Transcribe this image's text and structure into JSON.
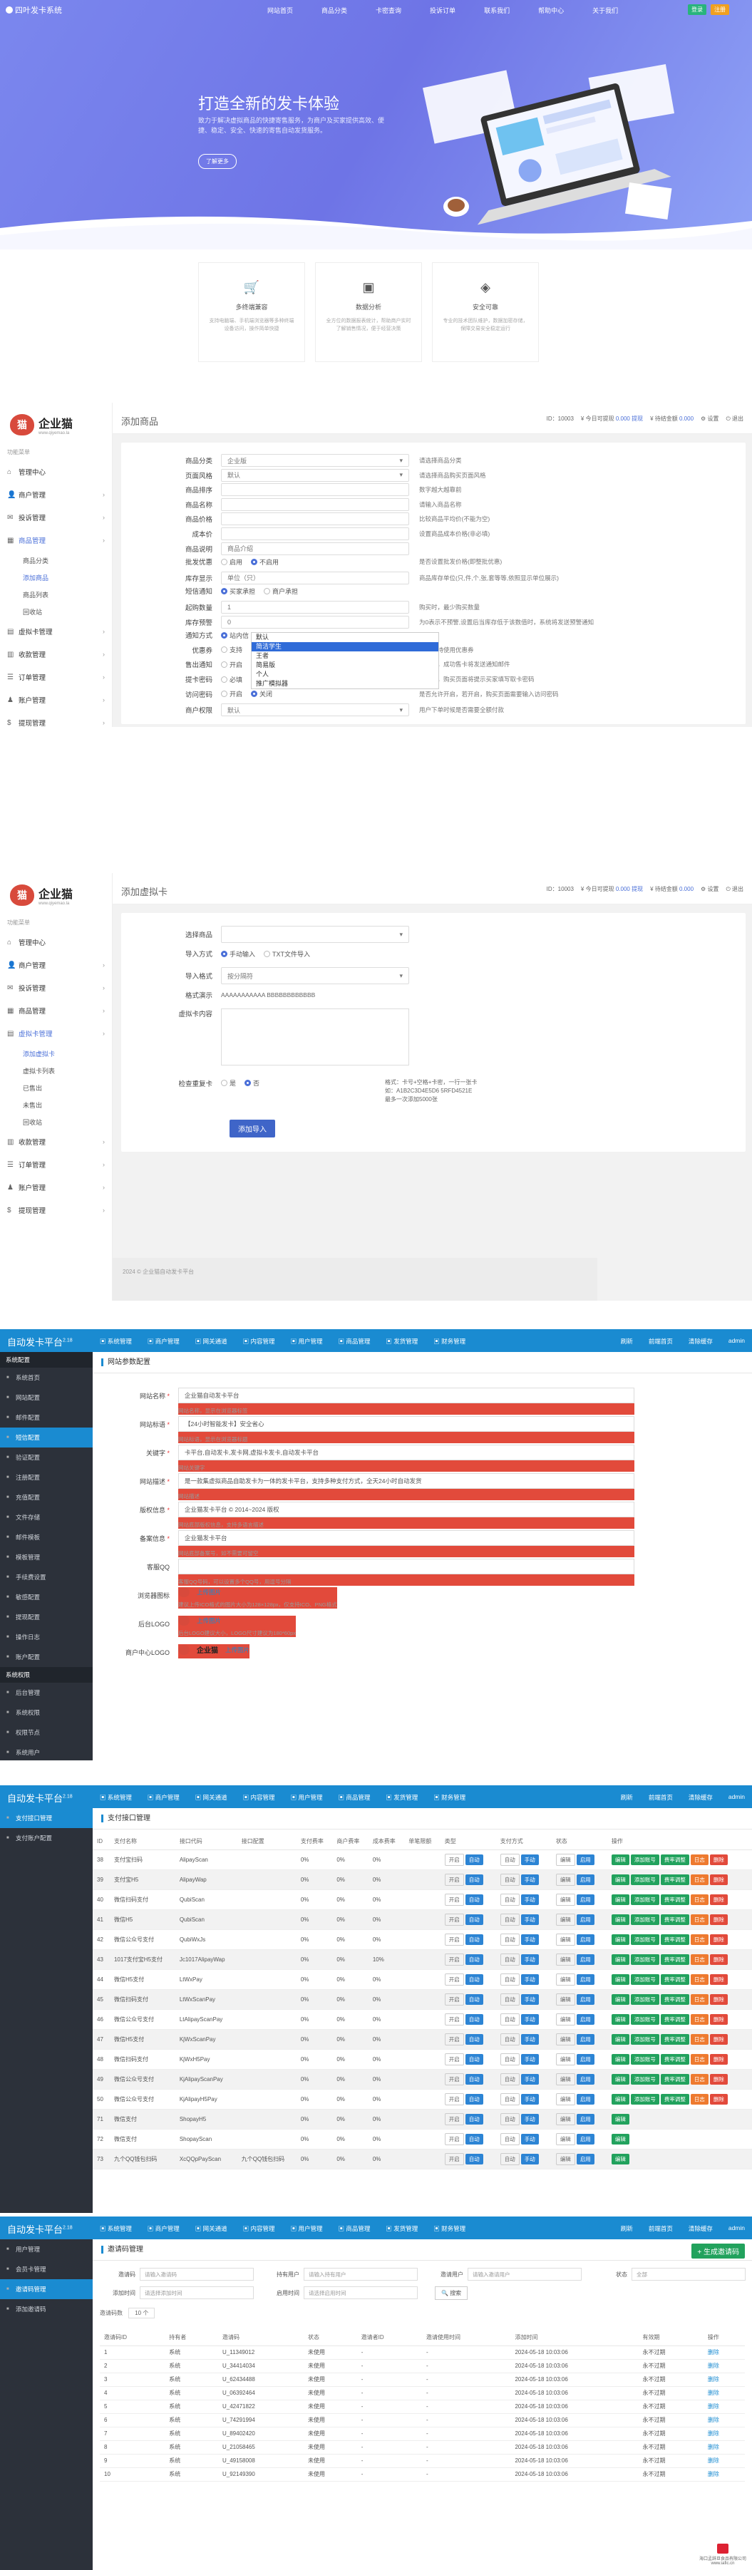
{
  "s1": {
    "logo": "四叶发卡系统",
    "nav": [
      "网站首页",
      "商品分类",
      "卡密查询",
      "投诉订单",
      "联系我们",
      "帮助中心",
      "关于我们"
    ],
    "nav_buttons": [
      "登录",
      "注册"
    ],
    "hero_title": "打造全新的发卡体验",
    "hero_sub": "致力于解决虚拟商品的快捷寄售服务，为商户及买家提供高效、便捷、稳定、安全、快速的寄售自动发货服务。",
    "hero_more": "了解更多",
    "features": [
      {
        "icon": "shopping-cart-icon",
        "title": "多终端兼容",
        "desc": "支持电脑端、手机端浏览器等多种终端设备访问，操作简单快捷"
      },
      {
        "icon": "data-report-icon",
        "title": "数据分析",
        "desc": "全方位的数据报表统计，帮助商户实时了解销售情况，便于经营决策"
      },
      {
        "icon": "safety-icon",
        "title": "安全可靠",
        "desc": "专业的技术团队维护，数据加密存储，保障交易安全稳定运行"
      }
    ]
  },
  "admin": {
    "brand": "企业猫",
    "brand_url": "www.qiyemao.la",
    "nav_caption": "功能菜单",
    "stats": {
      "id": "ID：10003",
      "balance_label": "¥ 今日可提现",
      "balance": "0.000",
      "withdraw_label": "提现",
      "freeze_label": "¥ 待结金额",
      "freeze": "0.000",
      "settings": "设置",
      "logout": "退出"
    }
  },
  "s2": {
    "page_title": "添加商品",
    "side": [
      {
        "icon": "home-icon",
        "label": "管理中心"
      },
      {
        "icon": "user-icon",
        "label": "商户管理",
        "arrow": true
      },
      {
        "icon": "cart-icon",
        "label": "投诉管理",
        "arrow": true
      },
      {
        "icon": "goods-icon",
        "label": "商品管理",
        "arrow": true,
        "on": true
      },
      {
        "sub": "商品分类"
      },
      {
        "sub": "添加商品",
        "on": true
      },
      {
        "sub": "商品列表"
      },
      {
        "sub": "回收站"
      },
      {
        "icon": "card-icon",
        "label": "虚拟卡管理",
        "arrow": true
      },
      {
        "icon": "chart-icon",
        "label": "收款管理",
        "arrow": true
      },
      {
        "icon": "order-icon",
        "label": "订单管理",
        "arrow": true
      },
      {
        "icon": "account-icon",
        "label": "账户管理",
        "arrow": true
      },
      {
        "icon": "money-icon",
        "label": "提现管理",
        "arrow": true
      }
    ],
    "rows": [
      {
        "label": "商品分类",
        "value": "企业版",
        "help": "请选择商品分类"
      },
      {
        "label": "页面风格",
        "value": "默认",
        "help": "请选择商品购买页面风格"
      },
      {
        "label": "商品排序",
        "value": "",
        "help": "数字越大越靠前"
      },
      {
        "label": "商品名称",
        "value": "",
        "help": "请输入商品名称"
      },
      {
        "label": "商品价格",
        "value": "",
        "help": "比较商品平均价(不能为空)"
      },
      {
        "label": "成本价",
        "value": "",
        "help": "设置商品成本价格(非必填)"
      },
      {
        "label": "商品说明",
        "value": "商品介绍",
        "help": ""
      },
      {
        "label": "批发优惠",
        "radios": [
          "启用",
          "不启用"
        ],
        "on": 1,
        "help": "是否设置批发价格(即整批优惠)"
      },
      {
        "label": "库存显示",
        "value": "单位（只）",
        "help": "商品库存单位(只,件,个,张,套等等,依照显示单位展示)"
      },
      {
        "label": "短信通知",
        "radios": [
          "买家承担",
          "商户承担"
        ],
        "on": 0,
        "help": ""
      },
      {
        "label": "起购数量",
        "value": "1",
        "help": "购买时，最少购买数量"
      },
      {
        "label": "库存预警",
        "value": "0",
        "help": "为0表示不预警,设置后当库存低于该数值时，系统将发送预警通知"
      },
      {
        "label": "通知方式",
        "radios": [
          "站内信",
          "邮件"
        ],
        "on": 0,
        "help": ""
      },
      {
        "label": "优惠券",
        "radios": [
          "支持",
          "不支持"
        ],
        "on": 1,
        "help": "是否支持使用优惠券"
      },
      {
        "label": "售出通知",
        "radios": [
          "开启",
          "关闭"
        ],
        "on": 1,
        "help": "开启后，成功售卡将发送通知邮件"
      },
      {
        "label": "提卡密码",
        "radios": [
          "必填",
          "选填",
          "关闭"
        ],
        "on": 2,
        "help": "开启后，购买页面将提示买家填写取卡密码"
      },
      {
        "label": "访问密码",
        "radios": [
          "开启",
          "关闭"
        ],
        "on": 1,
        "help": "是否允许开启，若开启，购买页面需要输入访问密码"
      },
      {
        "label": "商户权限",
        "value": "默认",
        "help": "用户下单时候是否需要全额付款"
      }
    ],
    "dropdown": [
      "默认",
      "简洁学生",
      "王者",
      "简易版",
      "个人",
      "推广模拟器"
    ]
  },
  "s3": {
    "page_title": "添加虚拟卡",
    "side": [
      {
        "icon": "home-icon",
        "label": "管理中心"
      },
      {
        "icon": "user-icon",
        "label": "商户管理",
        "arrow": true
      },
      {
        "icon": "cart-icon",
        "label": "投诉管理",
        "arrow": true
      },
      {
        "icon": "goods-icon",
        "label": "商品管理",
        "arrow": true
      },
      {
        "icon": "card-icon",
        "label": "虚拟卡管理",
        "arrow": true,
        "on": true
      },
      {
        "sub": "添加虚拟卡",
        "on": true
      },
      {
        "sub": "虚拟卡列表"
      },
      {
        "sub": "已售出"
      },
      {
        "sub": "未售出"
      },
      {
        "sub": "回收站"
      },
      {
        "icon": "chart-icon",
        "label": "收款管理",
        "arrow": true
      },
      {
        "icon": "order-icon",
        "label": "订单管理",
        "arrow": true
      },
      {
        "icon": "account-icon",
        "label": "账户管理",
        "arrow": true
      },
      {
        "icon": "money-icon",
        "label": "提现管理",
        "arrow": true
      }
    ],
    "goods_label": "选择商品",
    "goods_value": "",
    "import_label": "导入方式",
    "import_opts": [
      "手动输入",
      "TXT文件导入"
    ],
    "format_label": "导入格式",
    "format_value": "按分隔符",
    "demo_label": "格式演示",
    "demo_value": "AAAAAAAAAAA BBBBBBBBBBBB",
    "card_label": "虚拟卡内容",
    "check_label": "检查重复卡",
    "check_opts": [
      "是",
      "否"
    ],
    "help": [
      "格式：卡号+空格+卡密，一行一张卡",
      "如：A1B2C3D4E5D6 5RFD4521E",
      "最多一次添加5000张"
    ],
    "submit": "添加导入",
    "footer": "2024 © 企业猫自动发卡平台"
  },
  "blue": {
    "title": "自动发卡平台",
    "version": "2.18",
    "menu": [
      "系统管理",
      "商户管理",
      "网关通道",
      "内容管理",
      "用户管理",
      "商品管理",
      "发货管理",
      "财务管理"
    ],
    "right": [
      "刷新",
      "前端首页",
      "清除缓存",
      "admin"
    ]
  },
  "s4": {
    "side_group": "系统配置",
    "side": [
      "系统首页",
      "网站配置",
      "邮件配置",
      "短信配置",
      "验证配置",
      "注册配置",
      "充值配置",
      "文件存储",
      "邮件模板",
      "模板管理",
      "手续费设置",
      "敏感配置",
      "提现配置",
      "操作日志",
      "账户配置"
    ],
    "side_on": 3,
    "side_group2": "系统权限",
    "side2": [
      "后台管理",
      "系统权限",
      "权限节点",
      "系统用户",
      "后台操作日志",
      "用户操作日志"
    ],
    "head": "网站参数配置",
    "rows": [
      {
        "label": "网站名称",
        "req": true,
        "value": "企业猫自动发卡平台",
        "help": "网站名称，显示在浏览器标签"
      },
      {
        "label": "网站标语",
        "req": true,
        "value": "【24小时智能发卡】安全省心",
        "help": "网站标语，显示在浏览器标题"
      },
      {
        "label": "关键字",
        "req": true,
        "value": "卡平台,自动发卡,发卡网,虚拟卡发卡,自动发卡平台",
        "help": "网站关键字"
      },
      {
        "label": "网站描述",
        "req": true,
        "value": "是一款集虚拟商品自助发卡为一体的发卡平台，支持多种支付方式，全天24小时自动发货",
        "help": "网站描述"
      },
      {
        "label": "版权信息",
        "req": true,
        "value": "企业猫发卡平台 © 2014~2024 版权",
        "help": "网站底部版权信息，支持多语言描述"
      },
      {
        "label": "备案信息",
        "req": true,
        "value": "企业猫发卡平台",
        "help": "网站底部备案号，如不需要可留空"
      },
      {
        "label": "客服QQ",
        "req": false,
        "value": "",
        "help": "客服QQ号码，可以设置多个QQ号，用逗号分隔"
      }
    ],
    "logos": [
      {
        "label": "浏览器图标",
        "btn": "上传图片",
        "help": "建议上传ICO格式的图片大小为128×128px，仅支持ICO、PNG格式"
      },
      {
        "label": "后台LOGO",
        "btn": "上传图片",
        "help": "后台LOGO建议大小，LOGO尺寸建议为180*60px"
      },
      {
        "label": "商户中心LOGO",
        "btn": "上传图片",
        "help": ""
      }
    ],
    "brand": "企业猫"
  },
  "s5": {
    "side": [
      "支付接口管理",
      "支付账户配置"
    ],
    "head": "支付接口管理",
    "cols": [
      "ID",
      "支付名称",
      "接口代码",
      "接口配置",
      "支付费率",
      "商户费率",
      "成本费率",
      "单笔限额",
      "类型",
      "支付方式",
      "状态",
      "操作"
    ],
    "rows": [
      [
        "38",
        "支付宝扫码",
        "AlipayScan",
        "",
        "0%",
        "0%",
        "0%",
        "开启"
      ],
      [
        "39",
        "支付宝H5",
        "AlipayWap",
        "",
        "0%",
        "0%",
        "0%",
        "开启"
      ],
      [
        "40",
        "微信扫码支付",
        "QubiScan",
        "",
        "0%",
        "0%",
        "0%",
        "开启"
      ],
      [
        "41",
        "微信H5",
        "QubiScan",
        "",
        "0%",
        "0%",
        "0%",
        "开启"
      ],
      [
        "42",
        "微信公众号支付",
        "QubiWxJs",
        "",
        "0%",
        "0%",
        "0%",
        "开启"
      ],
      [
        "43",
        "1017支付宝H5支付",
        "Jc1017AlipayWap",
        "",
        "0%",
        "0%",
        "10%",
        "开启"
      ],
      [
        "44",
        "微信H5支付",
        "LtWxPay",
        "",
        "0%",
        "0%",
        "0%",
        "开启"
      ],
      [
        "45",
        "微信扫码支付",
        "LtWxScanPay",
        "",
        "0%",
        "0%",
        "0%",
        "开启"
      ],
      [
        "46",
        "微信公众号支付",
        "LtAlipayScanPay",
        "",
        "0%",
        "0%",
        "0%",
        "开启"
      ],
      [
        "47",
        "微信H5支付",
        "KjWxScanPay",
        "",
        "0%",
        "0%",
        "0%",
        "开启"
      ],
      [
        "48",
        "微信扫码支付",
        "KjWxH5Pay",
        "",
        "0%",
        "0%",
        "0%",
        "开启"
      ],
      [
        "49",
        "微信公众号支付",
        "KjAlipayScanPay",
        "",
        "0%",
        "0%",
        "0%",
        "开启"
      ],
      [
        "50",
        "微信公众号支付",
        "KjAlipayH5Pay",
        "",
        "0%",
        "0%",
        "0%",
        "开启"
      ],
      [
        "71",
        "微信支付",
        "ShopayH5",
        "",
        "0%",
        "0%",
        "0%",
        "开启"
      ],
      [
        "72",
        "微信支付",
        "ShopayScan",
        "",
        "0%",
        "0%",
        "0%",
        "开启"
      ],
      [
        "73",
        "九个QQ钱包扫码",
        "XcQQpPayScan",
        "九个QQ钱包扫码",
        "0%",
        "0%",
        "0%",
        "开启"
      ]
    ],
    "type_btn": "开启",
    "mode_btns": [
      "自动",
      "手动"
    ],
    "status_btns": [
      "启用",
      "编辑"
    ],
    "ops": [
      "编辑",
      "添加账号",
      "费率调整",
      "日志",
      "删除"
    ]
  },
  "s6": {
    "side": [
      "用户管理",
      "会员卡管理",
      "邀请码管理",
      "添加邀请码"
    ],
    "side_on": 2,
    "head": "邀请码管理",
    "add_btn": "+ 生成邀请码",
    "filters": [
      {
        "label": "邀请码",
        "ph": "请输入邀请码"
      },
      {
        "label": "持有用户",
        "ph": "请输入持有用户"
      },
      {
        "label": "邀请用户",
        "ph": "请输入邀请用户"
      },
      {
        "label": "状态",
        "ph": "全部"
      },
      {
        "label": "添加时间",
        "ph": "请选择添加时间"
      },
      {
        "label": "启用时间",
        "ph": "请选择启用时间"
      }
    ],
    "search_btn": "搜索",
    "count_label": "邀请码数",
    "count_value": "10 个",
    "cols": [
      "邀请码ID",
      "持有者",
      "邀请码",
      "状态",
      "邀请者ID",
      "邀请使用时间",
      "添加时间",
      "有效期",
      "操作"
    ],
    "rows": [
      [
        "1",
        "系统",
        "U_11349012",
        "未使用",
        "-",
        "-",
        "2024-05-18 10:03:06",
        "永不过期",
        "删除"
      ],
      [
        "2",
        "系统",
        "U_34414034",
        "未使用",
        "-",
        "-",
        "2024-05-18 10:03:06",
        "永不过期",
        "删除"
      ],
      [
        "3",
        "系统",
        "U_62434488",
        "未使用",
        "-",
        "-",
        "2024-05-18 10:03:06",
        "永不过期",
        "删除"
      ],
      [
        "4",
        "系统",
        "U_06392464",
        "未使用",
        "-",
        "-",
        "2024-05-18 10:03:06",
        "永不过期",
        "删除"
      ],
      [
        "5",
        "系统",
        "U_42471822",
        "未使用",
        "-",
        "-",
        "2024-05-18 10:03:06",
        "永不过期",
        "删除"
      ],
      [
        "6",
        "系统",
        "U_74291994",
        "未使用",
        "-",
        "-",
        "2024-05-18 10:03:06",
        "永不过期",
        "删除"
      ],
      [
        "7",
        "系统",
        "U_89402420",
        "未使用",
        "-",
        "-",
        "2024-05-18 10:03:06",
        "永不过期",
        "删除"
      ],
      [
        "8",
        "系统",
        "U_21058465",
        "未使用",
        "-",
        "-",
        "2024-05-18 10:03:06",
        "永不过期",
        "删除"
      ],
      [
        "9",
        "系统",
        "U_49158008",
        "未使用",
        "-",
        "-",
        "2024-05-18 10:03:06",
        "永不过期",
        "删除"
      ],
      [
        "10",
        "系统",
        "U_92149390",
        "未使用",
        "-",
        "-",
        "2024-05-18 10:03:06",
        "永不过期",
        "删除"
      ]
    ],
    "watermark": "海口孟辞旦食品有限公司",
    "watermark_url": "www.iafic.cn"
  }
}
